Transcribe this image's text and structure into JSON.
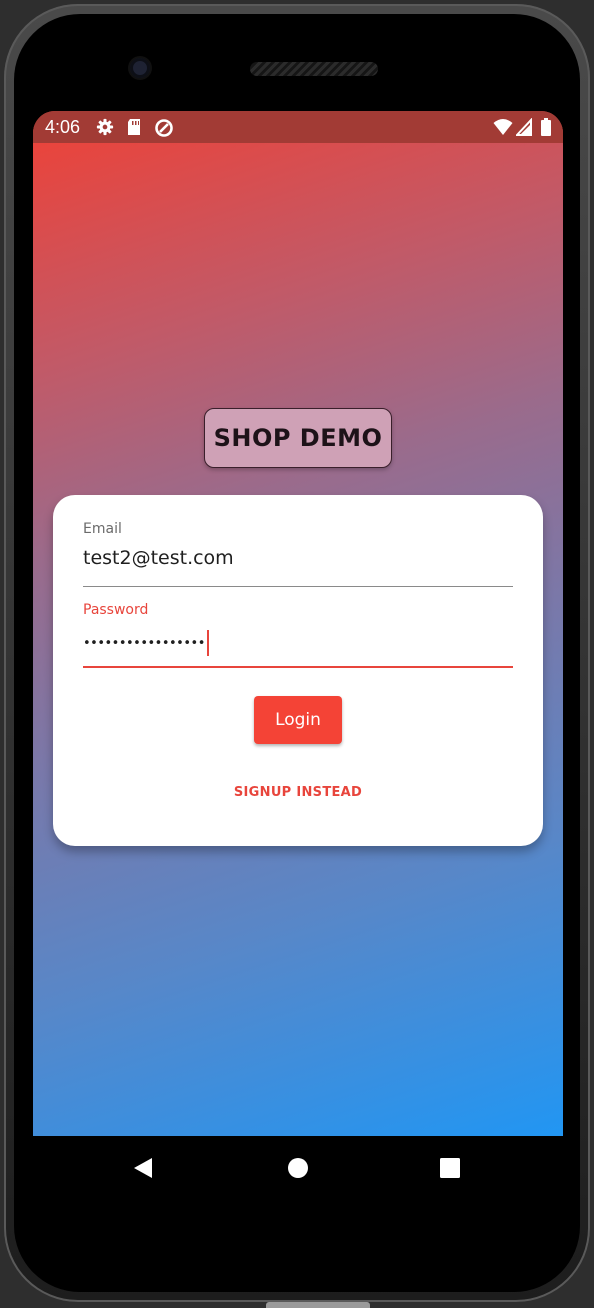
{
  "status_bar": {
    "time": "4:06",
    "left_icons": [
      "settings-icon",
      "sd-card-icon",
      "data-saver-icon"
    ],
    "right_icons": [
      "wifi-icon",
      "signal-icon",
      "battery-icon"
    ],
    "background": "#a23b35"
  },
  "app": {
    "title": "SHOP DEMO",
    "gradient_start": "#ef4136",
    "gradient_end": "#2196f3"
  },
  "form": {
    "email": {
      "label": "Email",
      "value": "test2@test.com"
    },
    "password": {
      "label": "Password",
      "masked_value": "•••••••••••••••••",
      "focused": true
    },
    "login_label": "Login",
    "signup_label": "SIGNUP INSTEAD",
    "accent_color": "#f44336"
  },
  "nav_bar": {
    "buttons": [
      "back-icon",
      "home-icon",
      "recents-icon"
    ]
  }
}
